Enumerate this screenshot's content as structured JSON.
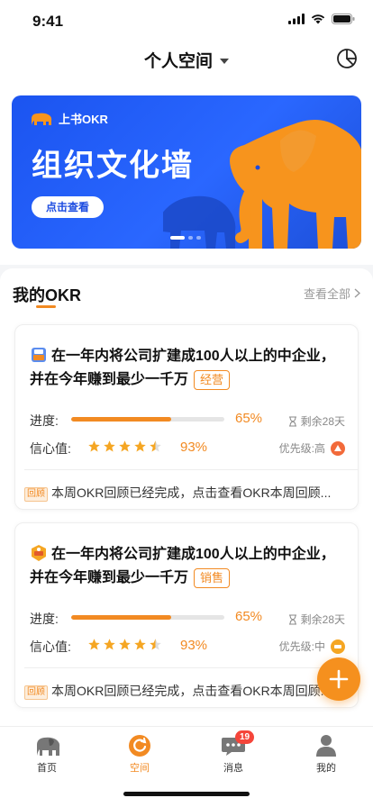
{
  "status": {
    "time": "9:41"
  },
  "nav": {
    "title": "个人空间",
    "chart_icon": "pie-chart-icon"
  },
  "banner": {
    "brand": "上书OKR",
    "title": "组织文化墙",
    "button": "点击查看",
    "slide_count": 3,
    "active_slide": 1
  },
  "section": {
    "title": "我的OKR",
    "view_all": "查看全部"
  },
  "okrs": [
    {
      "title": "在一年内将公司扩建成100人以上的中企业，并在今年赚到最少一千万",
      "tag": "经营",
      "progress_label": "进度:",
      "progress": 0.65,
      "progress_text": "65%",
      "remaining": "剩余28天",
      "confidence_label": "信心值:",
      "stars": 4.5,
      "confidence_text": "93%",
      "priority": "优先级:高",
      "review_badge": "回顾",
      "review": "本周OKR回顾已经完成，点击查看OKR本周回顾..."
    },
    {
      "title": "在一年内将公司扩建成100人以上的中企业，并在今年赚到最少一千万",
      "tag": "销售",
      "progress_label": "进度:",
      "progress": 0.65,
      "progress_text": "65%",
      "remaining": "剩余28天",
      "confidence_label": "信心值:",
      "stars": 4.5,
      "confidence_text": "93%",
      "priority": "优先级:中",
      "review_badge": "回顾",
      "review": "本周OKR回顾已经完成，点击查看OKR本周回顾..."
    }
  ],
  "tabs": [
    {
      "label": "首页",
      "icon": "elephant-icon"
    },
    {
      "label": "空间",
      "icon": "space-icon",
      "active": true
    },
    {
      "label": "消息",
      "icon": "message-icon",
      "badge": "19"
    },
    {
      "label": "我的",
      "icon": "user-icon"
    }
  ],
  "colors": {
    "accent": "#f28a22",
    "banner_blue": "#2a67ff",
    "priority_high": "#f26a3a",
    "priority_mid": "#f5a623"
  }
}
